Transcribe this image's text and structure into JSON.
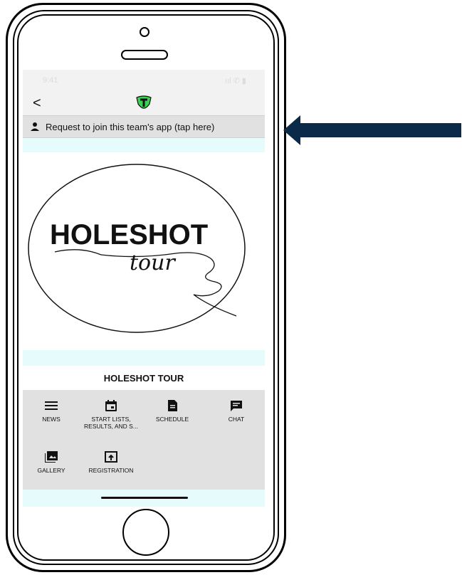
{
  "status_bar": {
    "time": "9:41",
    "icons": "ııl ✆ ▮"
  },
  "app_bar": {
    "back_glyph": "<"
  },
  "request_bar": {
    "label": "Request to join this team's app (tap here)"
  },
  "banner": {
    "logo_text_line1": "HOLESHOT",
    "logo_text_line2": "tour"
  },
  "team": {
    "name": "HOLESHOT TOUR"
  },
  "menu": {
    "items": [
      {
        "label": "NEWS",
        "icon": "list-icon"
      },
      {
        "label": "START LISTS, RESULTS, AND S...",
        "icon": "calendar-icon"
      },
      {
        "label": "SCHEDULE",
        "icon": "document-icon"
      },
      {
        "label": "CHAT",
        "icon": "chat-icon"
      },
      {
        "label": "GALLERY",
        "icon": "gallery-icon"
      },
      {
        "label": "REGISTRATION",
        "icon": "registration-icon"
      }
    ]
  },
  "colors": {
    "accent_green": "#39d353",
    "arrow_fill": "#0b2a4a",
    "menu_bg": "#e1e1e1",
    "cyan_strip": "#e6fbfb"
  }
}
